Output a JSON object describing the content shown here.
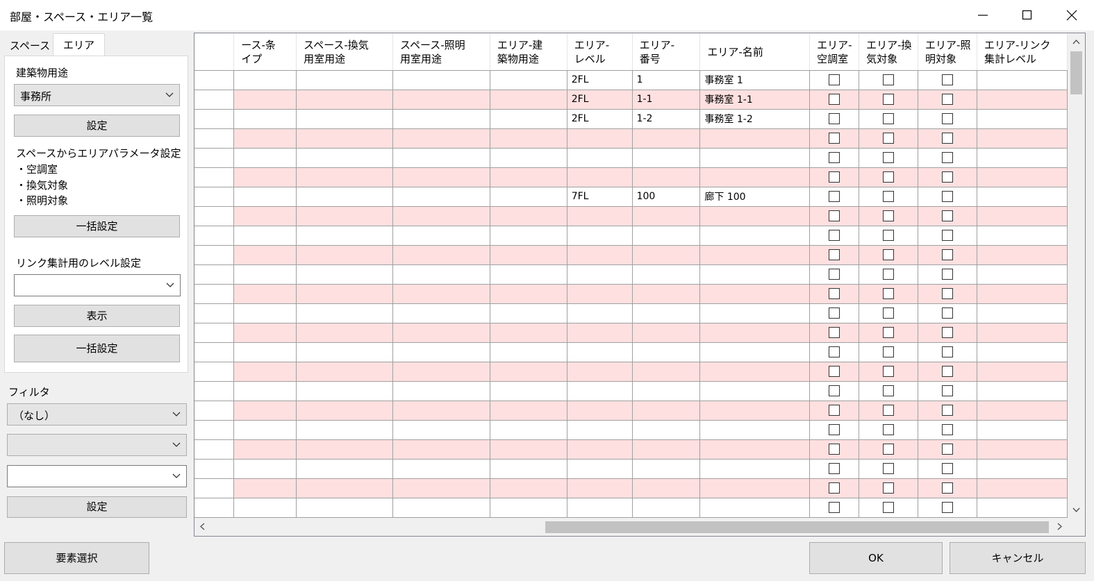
{
  "window": {
    "title": "部屋・スペース・エリア一覧"
  },
  "left_panel": {
    "tabs": [
      {
        "label": "スペース",
        "active": false
      },
      {
        "label": "エリア",
        "active": true
      }
    ],
    "building_use": {
      "label": "建築物用途",
      "value": "事務所",
      "set_button": "設定"
    },
    "area_params": {
      "label": "スペースからエリアパラメータ設定",
      "items": [
        "・空調室",
        "・換気対象",
        "・照明対象"
      ],
      "bulk_button": "一括設定"
    },
    "link_level": {
      "label": "リンク集計用のレベル設定",
      "value": "",
      "show_button": "表示",
      "bulk_button": "一括設定"
    },
    "filter": {
      "label": "フィルタ",
      "select1": "（なし）",
      "select2": "",
      "select3": "",
      "set_button": "設定"
    }
  },
  "grid": {
    "columns": [
      {
        "key": "rowhead",
        "label1": "",
        "label2": ""
      },
      {
        "key": "space_cond",
        "label1": "ース-条",
        "label2": "イプ"
      },
      {
        "key": "space_vent",
        "label1": "スペース-換気",
        "label2": "用室用途"
      },
      {
        "key": "space_light",
        "label1": "スペース-照明",
        "label2": "用室用途"
      },
      {
        "key": "area_bldg",
        "label1": "エリア-建",
        "label2": "築物用途"
      },
      {
        "key": "area_level",
        "label1": "エリア-",
        "label2": "レベル"
      },
      {
        "key": "area_num",
        "label1": "エリア-",
        "label2": "番号"
      },
      {
        "key": "area_name",
        "label1": "エリア-名前",
        "label2": ""
      },
      {
        "key": "area_ac",
        "label1": "エリア-",
        "label2": "空調室"
      },
      {
        "key": "area_vent",
        "label1": "エリア-換",
        "label2": "気対象"
      },
      {
        "key": "area_light",
        "label1": "エリア-照",
        "label2": "明対象"
      },
      {
        "key": "area_link",
        "label1": "エリア-リンク",
        "label2": "集計レベル"
      }
    ],
    "rows": [
      {
        "level": "2FL",
        "number": "1",
        "name": "事務室 1"
      },
      {
        "level": "2FL",
        "number": "1-1",
        "name": "事務室 1-1"
      },
      {
        "level": "2FL",
        "number": "1-2",
        "name": "事務室 1-2"
      },
      {
        "level": "",
        "number": "",
        "name": ""
      },
      {
        "level": "",
        "number": "",
        "name": ""
      },
      {
        "level": "",
        "number": "",
        "name": ""
      },
      {
        "level": "7FL",
        "number": "100",
        "name": "廊下 100"
      },
      {
        "level": "",
        "number": "",
        "name": ""
      },
      {
        "level": "",
        "number": "",
        "name": ""
      },
      {
        "level": "",
        "number": "",
        "name": ""
      },
      {
        "level": "",
        "number": "",
        "name": ""
      },
      {
        "level": "",
        "number": "",
        "name": ""
      },
      {
        "level": "",
        "number": "",
        "name": ""
      },
      {
        "level": "",
        "number": "",
        "name": ""
      },
      {
        "level": "",
        "number": "",
        "name": ""
      },
      {
        "level": "",
        "number": "",
        "name": ""
      },
      {
        "level": "",
        "number": "",
        "name": ""
      },
      {
        "level": "",
        "number": "",
        "name": ""
      },
      {
        "level": "",
        "number": "",
        "name": ""
      },
      {
        "level": "",
        "number": "",
        "name": ""
      },
      {
        "level": "",
        "number": "",
        "name": ""
      },
      {
        "level": "",
        "number": "",
        "name": ""
      },
      {
        "level": "",
        "number": "",
        "name": ""
      },
      {
        "level": "",
        "number": "",
        "name": ""
      }
    ]
  },
  "footer": {
    "select_elements": "要素選択",
    "ok": "OK",
    "cancel": "キャンセル"
  },
  "colors": {
    "alt_row": "#ffe0e0",
    "button_bg": "#e1e1e1",
    "background": "#f0f0f0"
  }
}
